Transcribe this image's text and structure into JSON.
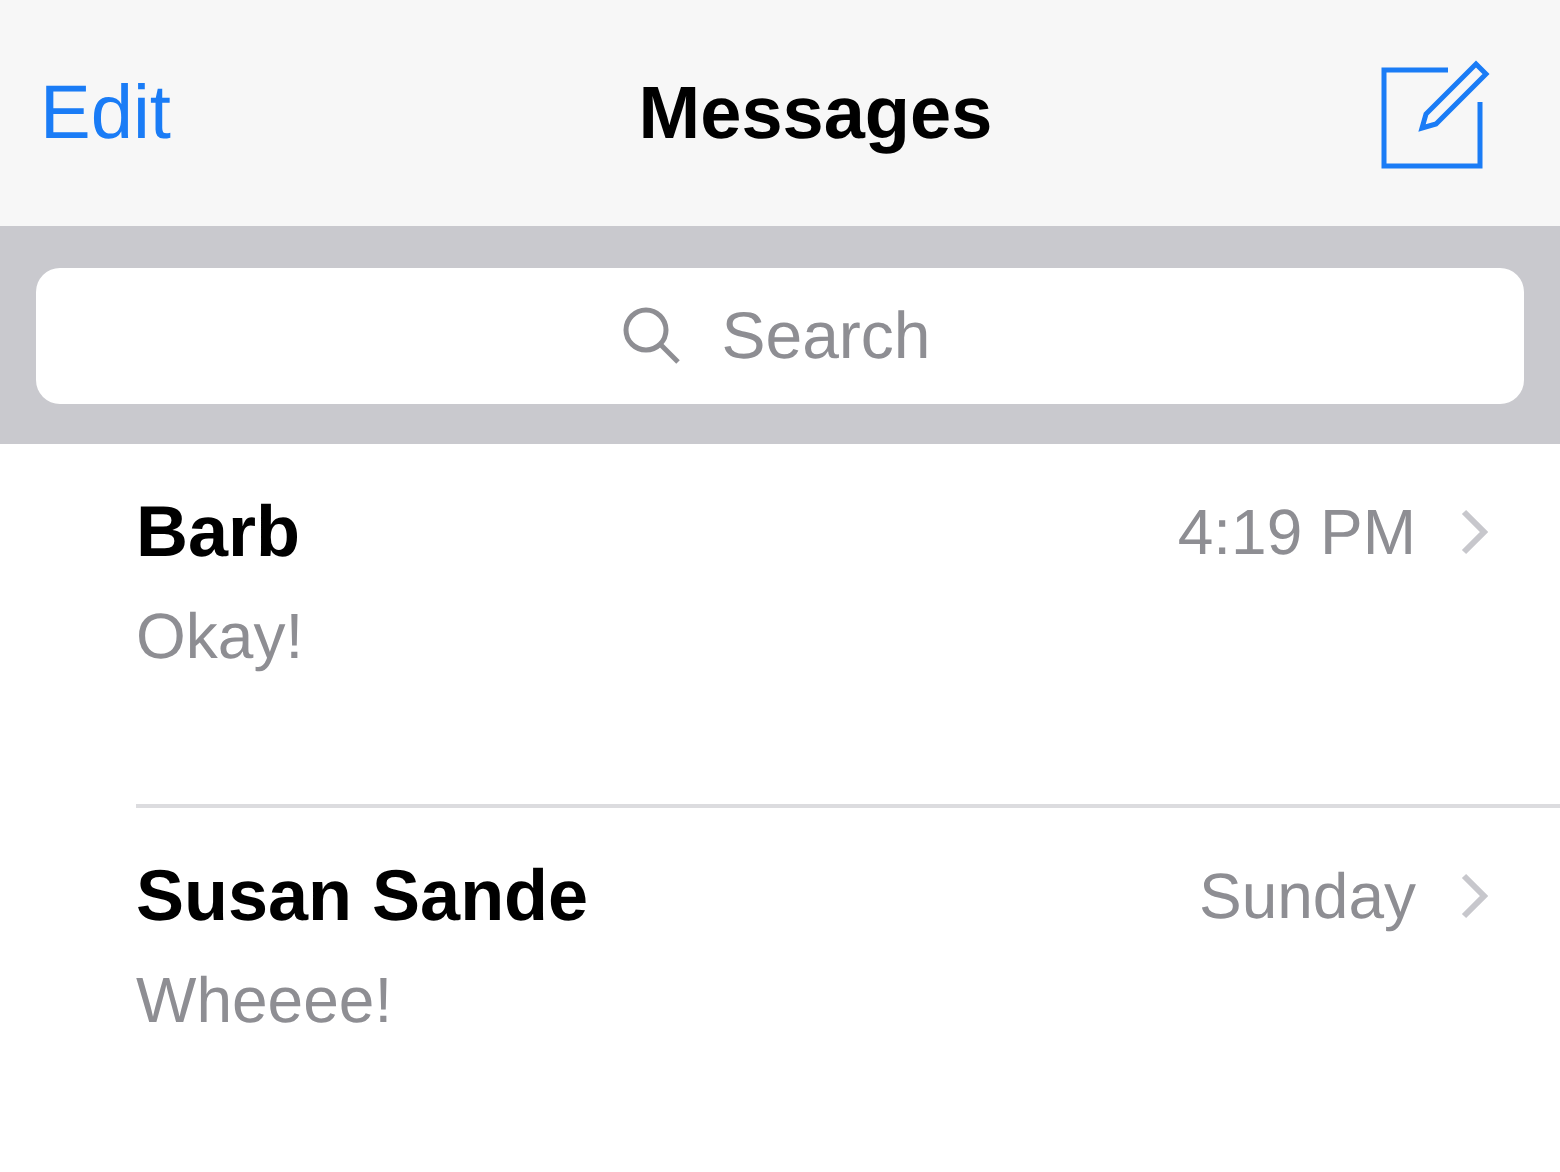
{
  "nav_bar": {
    "left_button": "Edit",
    "title": "Messages"
  },
  "search": {
    "placeholder": "Search"
  },
  "conversations": [
    {
      "name": "Barb",
      "time": "4:19 PM",
      "preview": "Okay!"
    },
    {
      "name": "Susan Sande",
      "time": "Sunday",
      "preview": "Wheeee!"
    }
  ]
}
